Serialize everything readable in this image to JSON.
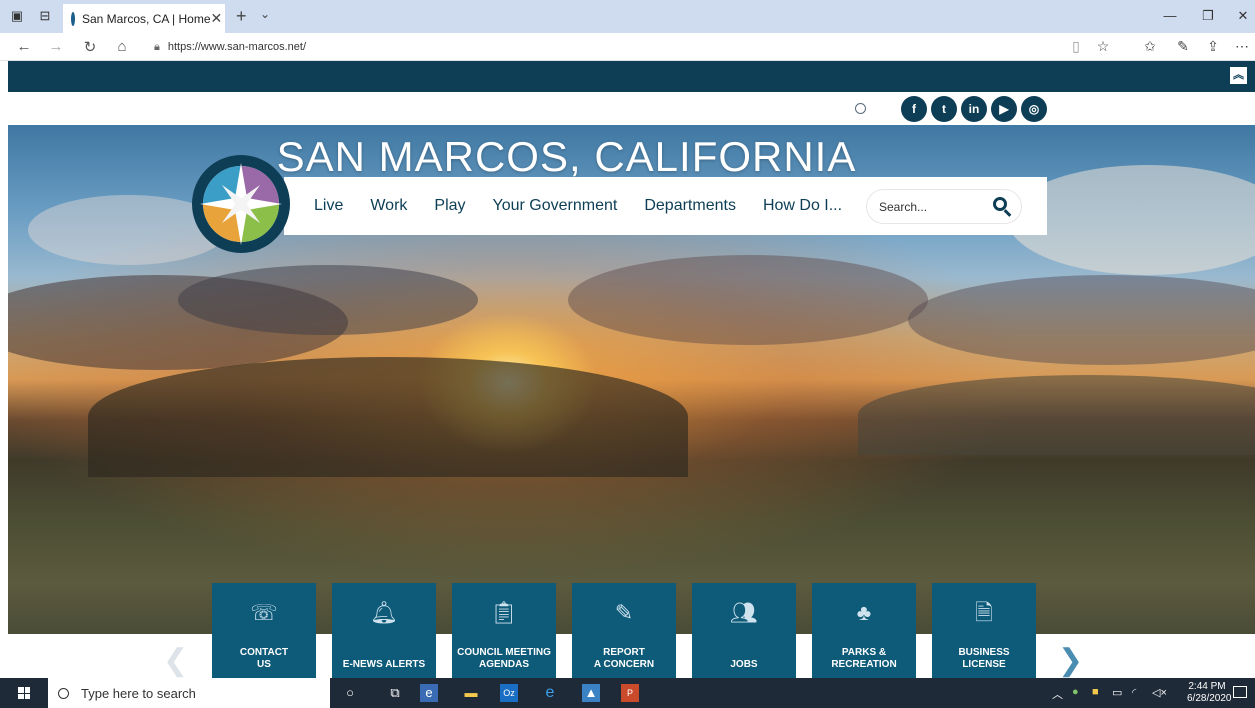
{
  "browser": {
    "tab_title": "San Marcos, CA | Home",
    "tab_close": "✕",
    "new_tab": "+",
    "tab_menu": "⌄",
    "url": "https://www.san-marcos.net/",
    "window_controls": {
      "minimize": "—",
      "restore": "❐",
      "close": "✕"
    }
  },
  "site": {
    "title": "SAN MARCOS, CALIFORNIA",
    "nav": [
      "Live",
      "Work",
      "Play",
      "Your Government",
      "Departments",
      "How Do I..."
    ],
    "search_placeholder": "Search...",
    "social": [
      {
        "name": "facebook",
        "glyph": "f"
      },
      {
        "name": "twitter",
        "glyph": "t"
      },
      {
        "name": "linkedin",
        "glyph": "in"
      },
      {
        "name": "youtube",
        "glyph": "▶"
      },
      {
        "name": "instagram",
        "glyph": "◎"
      }
    ],
    "quick_links": [
      {
        "line1": "CONTACT",
        "line2": "US",
        "icon": "contact-icon"
      },
      {
        "line1": "",
        "line2": "E-NEWS ALERTS",
        "icon": "bell-icon"
      },
      {
        "line1": "COUNCIL MEETING",
        "line2": "AGENDAS",
        "icon": "clipboard-icon"
      },
      {
        "line1": "REPORT",
        "line2": "A CONCERN",
        "icon": "pencil-icon"
      },
      {
        "line1": "",
        "line2": "JOBS",
        "icon": "people-icon"
      },
      {
        "line1": "PARKS &",
        "line2": "RECREATION",
        "icon": "tree-icon"
      },
      {
        "line1": "BUSINESS",
        "line2": "LICENSE",
        "icon": "document-icon"
      }
    ],
    "carousel": {
      "prev": "❮",
      "next": "❯"
    }
  },
  "taskbar": {
    "search_placeholder": "Type here to search",
    "time": "2:44 PM",
    "date": "6/28/2020"
  },
  "colors": {
    "brand_dark": "#0d3e55",
    "tile": "#0d5a79",
    "taskbar": "#1f2a38"
  }
}
